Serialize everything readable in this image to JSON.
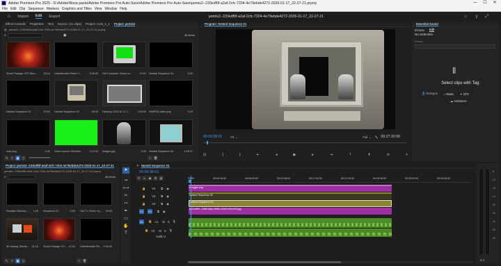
{
  "window": {
    "app_label": "Adobe Premiere Pro 2025",
    "file_path": "Adobe Premiere Pro 2025 - D:\\Adobe\\Nova pasta\\Adobe Premiere Pro Auto-Save\\Adobe Premiere Pro Auto-Save\\pemis2--233edf0f-a2af-2cfc-7204-4e79ebde4272-2026-01-17_22-27-21.prproj",
    "minimize": "—",
    "maximize": "☐",
    "close": "✕"
  },
  "menu": [
    "File",
    "Edit",
    "Clip",
    "Sequence",
    "Markers",
    "Graphics and Titles",
    "View",
    "Window",
    "Help"
  ],
  "appbar": {
    "tabs": [
      "Import",
      "Edit",
      "Export"
    ],
    "active": "Edit",
    "sequence_title": "pemis2--233edf0f-a2af-2cfc-7204-4e79ebde4272-2026-01-17_22-27-21"
  },
  "top_left": {
    "tabs": [
      "Effect Controls",
      "Properties",
      "Text",
      "Source: (no clips)",
      "Project: cock_1_1",
      "Project: pemis2"
    ],
    "active": "Project: pemis2",
    "path": "pemis2--233edf0f-a2af-2cfc-7204-4e79ebde4272-2026-01-17_22-27-21.prproj",
    "items_count": "46 items",
    "thumbs": [
      {
        "name": "Stock Footage CRT Mon...",
        "dur": "29:14"
      },
      {
        "name": "Unbelievable Retro C...",
        "dur": "2:06:09"
      },
      {
        "name": "Old Computer Green sc...",
        "dur": "10:01"
      },
      {
        "name": "Nested Sequence 01",
        "dur": "9:20"
      },
      {
        "name": "Nested Sequence 02",
        "dur": "20:00"
      },
      {
        "name": "Nested Sequence 03",
        "dur": "36:05"
      },
      {
        "name": "Desktop 2024-01-17 1...",
        "dur": "1:59:00"
      },
      {
        "name": "WMPSU-Main.png",
        "dur": "4:29"
      },
      {
        "name": "stop.png",
        "dur": "4:29"
      },
      {
        "name": "Green screen Window...",
        "dur": "1:12:04"
      },
      {
        "name": "images.jpg",
        "dur": "4:29"
      },
      {
        "name": "Nested Sequence 04",
        "dur": "1:05:21"
      }
    ]
  },
  "program": {
    "tab": "Program: Nested Sequence 01",
    "timecode_in": "00:00:38:01",
    "fit": "Fit",
    "quality": "Full",
    "timecode_out": "00:27:32:09"
  },
  "essential_sound": {
    "title": "Essential Sound",
    "tabs": [
      "Browse",
      "Edit"
    ],
    "selection": "No Selection",
    "preset_label": "Preset",
    "heading": "Select clips with Tag:",
    "tags": [
      "Dialogue",
      "Music",
      "SFX",
      "Ambience"
    ]
  },
  "bottom_left": {
    "tab": "Project: pemis2--233edf0f-a2af-2cfc-7204-4e79ebde4272-2026-01-17_22-27-21",
    "path": "pemis2--233edf0f-a2af-2cfc-7204-4e79ebde4272-2026-01-17_22-27-21.prproj",
    "items_count": "46 items",
    "thumbs": [
      {
        "name": "Realistic Glitches ...",
        "dur": "1:59"
      },
      {
        "name": "Sequence 01",
        "dur": "0:00"
      },
      {
        "name": "Old TV Green Sc...",
        "dur": "15:00"
      },
      {
        "name": "4K Analog Televis...",
        "dur": "31:10"
      },
      {
        "name": "Stock Footage CR...",
        "dur": "12:10"
      },
      {
        "name": "Unbelievable Re...",
        "dur": "2:06:09"
      }
    ]
  },
  "timeline": {
    "tab": "Nested Sequence 01",
    "timecode": "00:00:38:01",
    "ruler": [
      "00:00",
      "00:04:16:00",
      "00:08:32:00",
      "00:12:48:00",
      "00:17:04:00",
      "00:21:20:00",
      "00:25:36:00",
      "00:29:52:00",
      "00:34:08:00"
    ],
    "video_tracks": [
      "V4",
      "V3",
      "V2",
      "V1"
    ],
    "audio_tracks": [
      "A1",
      "A2"
    ],
    "audio2_label": "Audio 2",
    "clips": {
      "v4": "dl-uggle.png",
      "v3": "Nested Sequence 04",
      "v2": "Nested Sequence 03",
      "v1": "afc14b99...1080-60px-9959-11b37e2b1933.jpg"
    }
  },
  "vu": {
    "labels": [
      "-6",
      "-12",
      "-18",
      "-24",
      "-30",
      "-36",
      "-42",
      "-48",
      "-54"
    ],
    "footer": "S S"
  },
  "colors": {
    "accent": "#3d9bf0",
    "purple_clip": "#9d2fa3",
    "green_clip": "#4e8a26",
    "olive_clip": "#8a8433",
    "program_bg": "#000000"
  }
}
